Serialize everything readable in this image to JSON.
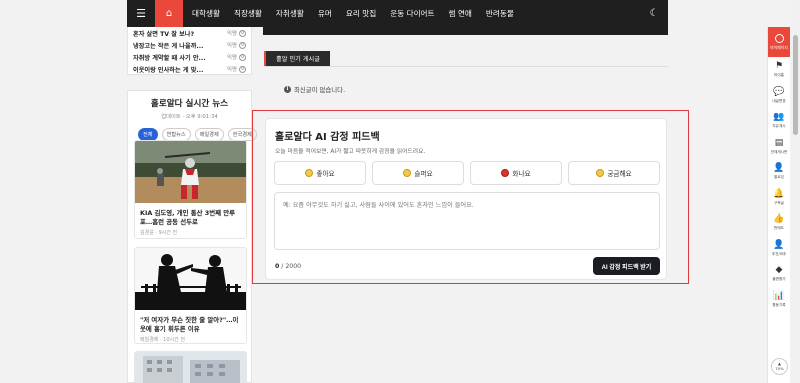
{
  "nav": {
    "menu_icon": "hamburger-icon",
    "home_icon": "home-icon",
    "items": [
      "대학생활",
      "직장생활",
      "자취생활",
      "유머",
      "요리 맛집",
      "운동 다이어트",
      "썸 연애",
      "반려동물"
    ],
    "theme_icon": "moon-icon",
    "accent": "#e9483b"
  },
  "top_posts": [
    {
      "title": "혼자 살면 TV 잘 보나?",
      "meta": "익명",
      "comments": "0"
    },
    {
      "title": "냉장고는 작은 게 나을까...",
      "meta": "익명",
      "comments": "0"
    },
    {
      "title": "자취방 계약할 때 사기 안...",
      "meta": "익명",
      "comments": "0"
    },
    {
      "title": "이웃이랑 인사하는 게 맞...",
      "meta": "익명",
      "comments": "0"
    }
  ],
  "news": {
    "title": "홀로알다 실시간 뉴스",
    "subtitle": "업데이트 · 오후 9:01:34",
    "tabs": [
      {
        "label": "전체",
        "active": true
      },
      {
        "label": "연합뉴스",
        "active": false
      },
      {
        "label": "매일경제",
        "active": false
      },
      {
        "label": "한국경제",
        "active": false
      }
    ],
    "articles": [
      {
        "title": "KIA 김도영, 개인 통산 3번째 만루포…홈런 공동 선두로",
        "meta": "김경윤 · 9시간 전"
      },
      {
        "title": "\"저 여자가 무슨 짓한 줄 알아?\"…이웃에 흉기 휘두른 이유",
        "meta": "매일경제 · 10시간 전"
      }
    ]
  },
  "board": {
    "tab_label": "홀알 인기 게시글",
    "empty_message": "최신글이 없습니다."
  },
  "feedback": {
    "title": "홀로알다 AI 감정 피드백",
    "description": "오늘 마음을 적어보면, AI가 짧고 따뜻하게 감정을 읽어드려요.",
    "emotions": [
      {
        "label": "좋아요",
        "color": "#f2c84b"
      },
      {
        "label": "슬퍼요",
        "color": "#f2c84b"
      },
      {
        "label": "화나요",
        "color": "#d9332b"
      },
      {
        "label": "궁금해요",
        "color": "#f2c84b"
      }
    ],
    "placeholder": "예: 요즘 아무것도 하기 싫고, 사람들 사이에 있어도 혼자인 느낌이 들어요.",
    "count_current": "0",
    "count_max": "/ 2000",
    "submit_label": "AI 감정 피드백 받기",
    "frame_color": "#e0393b"
  },
  "sidebar": {
    "top_label": "마이페이지",
    "items": [
      {
        "label": "마이홈",
        "icon": "flag-icon"
      },
      {
        "label": "내글변경",
        "icon": "chat-icon"
      },
      {
        "label": "자유게시",
        "icon": "users-icon"
      },
      {
        "label": "전체게시판",
        "icon": "list-icon"
      },
      {
        "label": "팔로잉",
        "icon": "user-plus-icon"
      },
      {
        "label": "구독글",
        "icon": "bell-icon"
      },
      {
        "label": "판매도",
        "icon": "thumb-icon"
      },
      {
        "label": "추천/비추",
        "icon": "user-icon"
      },
      {
        "label": "불편평가",
        "icon": "diamond-icon"
      },
      {
        "label": "활동기록",
        "icon": "chart-icon"
      }
    ],
    "zoom": "70%"
  }
}
